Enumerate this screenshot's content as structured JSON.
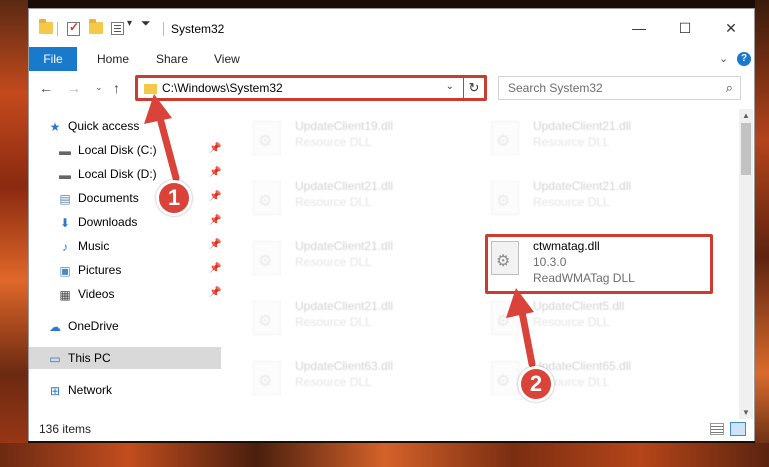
{
  "window": {
    "title": "System32",
    "controls": {
      "minimize": "—",
      "maximize": "☐",
      "close": "✕"
    }
  },
  "ribbon": {
    "tabs": [
      "File",
      "Home",
      "Share",
      "View"
    ],
    "expand_glyph": "⌄",
    "help_glyph": "?"
  },
  "navigation": {
    "back_glyph": "←",
    "forward_glyph": "→",
    "recent_glyph": "⌄",
    "up_glyph": "↑",
    "address": "C:\\Windows\\System32",
    "address_dropdown_glyph": "⌄",
    "refresh_glyph": "↻",
    "search_placeholder": "Search System32",
    "search_glyph": "⌕"
  },
  "sidebar": {
    "items": [
      {
        "label": "Quick access",
        "icon": "star-icon",
        "glyph": "★",
        "color": "#2b78d0",
        "pinned": false
      },
      {
        "label": "Local Disk (C:)",
        "icon": "drive-icon",
        "glyph": "▬",
        "color": "#666666",
        "pinned": true
      },
      {
        "label": "Local Disk (D:)",
        "icon": "drive-icon",
        "glyph": "▬",
        "color": "#666666",
        "pinned": true
      },
      {
        "label": "Documents",
        "icon": "documents-icon",
        "glyph": "▤",
        "color": "#5a7fb5",
        "pinned": true
      },
      {
        "label": "Downloads",
        "icon": "download-icon",
        "glyph": "⬇",
        "color": "#2b78d0",
        "pinned": true
      },
      {
        "label": "Music",
        "icon": "music-icon",
        "glyph": "♪",
        "color": "#2b78d0",
        "pinned": true
      },
      {
        "label": "Pictures",
        "icon": "pictures-icon",
        "glyph": "▣",
        "color": "#4a8ac0",
        "pinned": true
      },
      {
        "label": "Videos",
        "icon": "videos-icon",
        "glyph": "▦",
        "color": "#444444",
        "pinned": true
      },
      {
        "label": "OneDrive",
        "icon": "cloud-icon",
        "glyph": "☁",
        "color": "#2b78d0",
        "pinned": false
      },
      {
        "label": "This PC",
        "icon": "computer-icon",
        "glyph": "▭",
        "color": "#2b78d0",
        "pinned": false,
        "selected": true
      },
      {
        "label": "Network",
        "icon": "network-icon",
        "glyph": "⊞",
        "color": "#2b78d0",
        "pinned": false
      }
    ],
    "pin_glyph": "📌"
  },
  "files": {
    "faded": [
      {
        "name": "UpdateClient19.dll",
        "type": "Resource DLL"
      },
      {
        "name": "UpdateClient21.dll",
        "type": "Resource DLL"
      },
      {
        "name": "UpdateClient21.dll",
        "type": "Resource DLL"
      },
      {
        "name": "UpdateClient21.dll",
        "type": "Resource DLL"
      },
      {
        "name": "UpdateClient21.dll",
        "type": "Resource DLL"
      },
      {
        "name": "UpdateClient21.dll",
        "type": "Resource DLL"
      },
      {
        "name": "UpdateClient5.dll",
        "type": "Resource DLL"
      },
      {
        "name": "UpdateClient63.dll",
        "type": "Resource DLL"
      },
      {
        "name": "UpdateClient65.dll",
        "type": "Resource DLL"
      }
    ],
    "highlighted": {
      "name": "ctwmatag.dll",
      "version": "10.3.0",
      "description": "ReadWMATag DLL"
    }
  },
  "status": {
    "item_count": "136 items"
  },
  "callouts": {
    "step1": "1",
    "step2": "2"
  },
  "colors": {
    "accent": "#1979ca",
    "highlight": "#cc3b2e",
    "callout": "#d9433a"
  }
}
